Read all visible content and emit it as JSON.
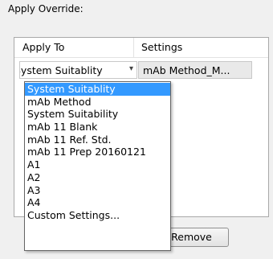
{
  "override": {
    "section_label": "Apply Override:",
    "columns": [
      "Apply To",
      "Settings"
    ],
    "row": {
      "apply_to_value": "System Suitablity",
      "settings_value": "mAb Method_M..."
    },
    "dropdown_options": [
      "System Suitablity",
      "mAb Method",
      "System Suitability",
      "mAb 11 Blank",
      "mAb 11 Ref. Std.",
      "mAb 11 Prep 20160121",
      "A1",
      "A2",
      "A3",
      "A4",
      "Custom Settings..."
    ],
    "selected_option": "System Suitablity",
    "remove_label": "Remove"
  },
  "colors": {
    "selection": "#3399ff",
    "panel_border": "#a9a9a9"
  },
  "icons": {
    "combo_arrow": "chevron-down-icon"
  }
}
